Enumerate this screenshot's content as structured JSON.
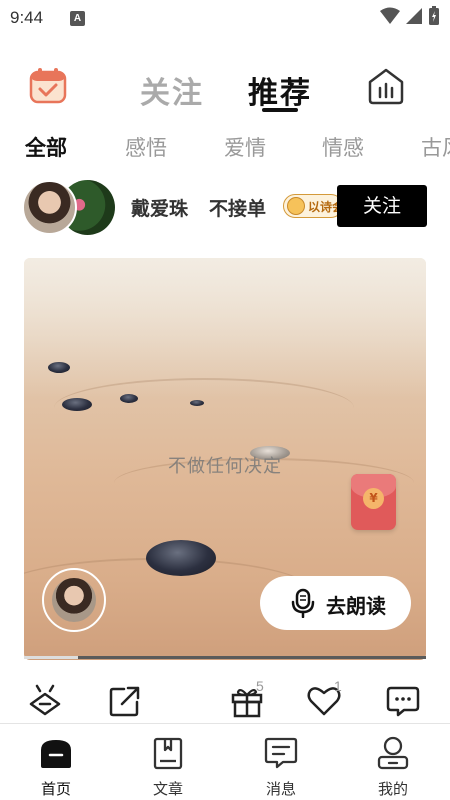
{
  "status_bar": {
    "time": "9:44",
    "a_icon": "A"
  },
  "header": {
    "tabs": [
      {
        "label": "关注",
        "active": false
      },
      {
        "label": "推荐",
        "active": true
      }
    ]
  },
  "categories": [
    {
      "label": "全部",
      "active": true
    },
    {
      "label": "感悟",
      "active": false
    },
    {
      "label": "爱情",
      "active": false
    },
    {
      "label": "情感",
      "active": false
    },
    {
      "label": "古风",
      "active": false
    }
  ],
  "post": {
    "author_name": "戴爱珠",
    "author_note": "不接单",
    "badge_text": "以诗会友",
    "follow_label": "关注",
    "quote": "不做任何决定",
    "read_label": "去朗读",
    "envelope_symbol": "¥"
  },
  "actions": {
    "gift_count": "5",
    "like_count": "1"
  },
  "bottom_nav": [
    {
      "label": "首页",
      "icon": "home-icon",
      "active": true
    },
    {
      "label": "文章",
      "icon": "book-icon",
      "active": false
    },
    {
      "label": "消息",
      "icon": "message-icon",
      "active": false
    },
    {
      "label": "我的",
      "icon": "profile-icon",
      "active": false
    }
  ],
  "colors": {
    "accent": "#000000",
    "envelope": "#e05a5a",
    "badge": "#d49a3a"
  }
}
